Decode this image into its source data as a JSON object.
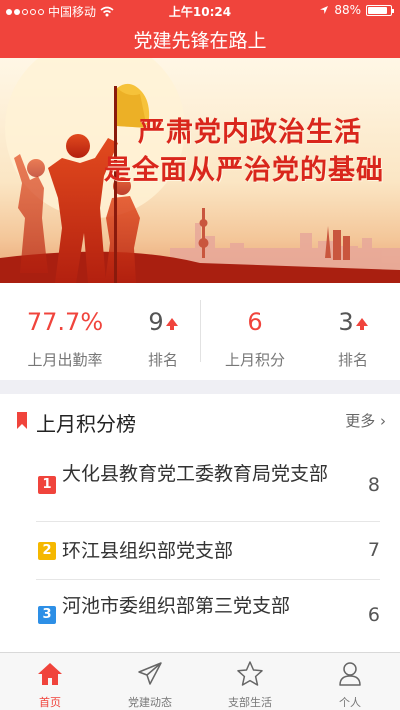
{
  "status": {
    "carrier": "中国移动",
    "time": "上午10:24",
    "battery": "88%",
    "battery_level": 0.88
  },
  "app": {
    "title": "党建先锋在路上"
  },
  "banner": {
    "line1": "严肃党内政治生活",
    "line2": "是全面从严治党的基础"
  },
  "stats": {
    "attendance": {
      "value": "77.7%",
      "label": "上月出勤率"
    },
    "attendance_rank": {
      "value": "9",
      "label": "排名"
    },
    "points": {
      "value": "6",
      "label": "上月积分"
    },
    "points_rank": {
      "value": "3",
      "label": "排名"
    }
  },
  "ranking": {
    "title": "上月积分榜",
    "more": "更多",
    "items": [
      {
        "rank": "1",
        "name": "大化县教育党工委教育局党支部",
        "score": "8",
        "color": "#f0443c"
      },
      {
        "rank": "2",
        "name": "环江县组织部党支部",
        "score": "7",
        "color": "#f5b800"
      },
      {
        "rank": "3",
        "name": "河池市委组织部第三党支部",
        "score": "6",
        "color": "#2d8fe6"
      }
    ]
  },
  "tabs": [
    {
      "label": "首页",
      "icon": "home-icon",
      "active": true
    },
    {
      "label": "党建动态",
      "icon": "paper-plane-icon",
      "active": false
    },
    {
      "label": "支部生活",
      "icon": "star-icon",
      "active": false
    },
    {
      "label": "个人",
      "icon": "person-icon",
      "active": false
    }
  ],
  "colors": {
    "accent": "#f0443c",
    "background_gap": "#efeff4"
  }
}
